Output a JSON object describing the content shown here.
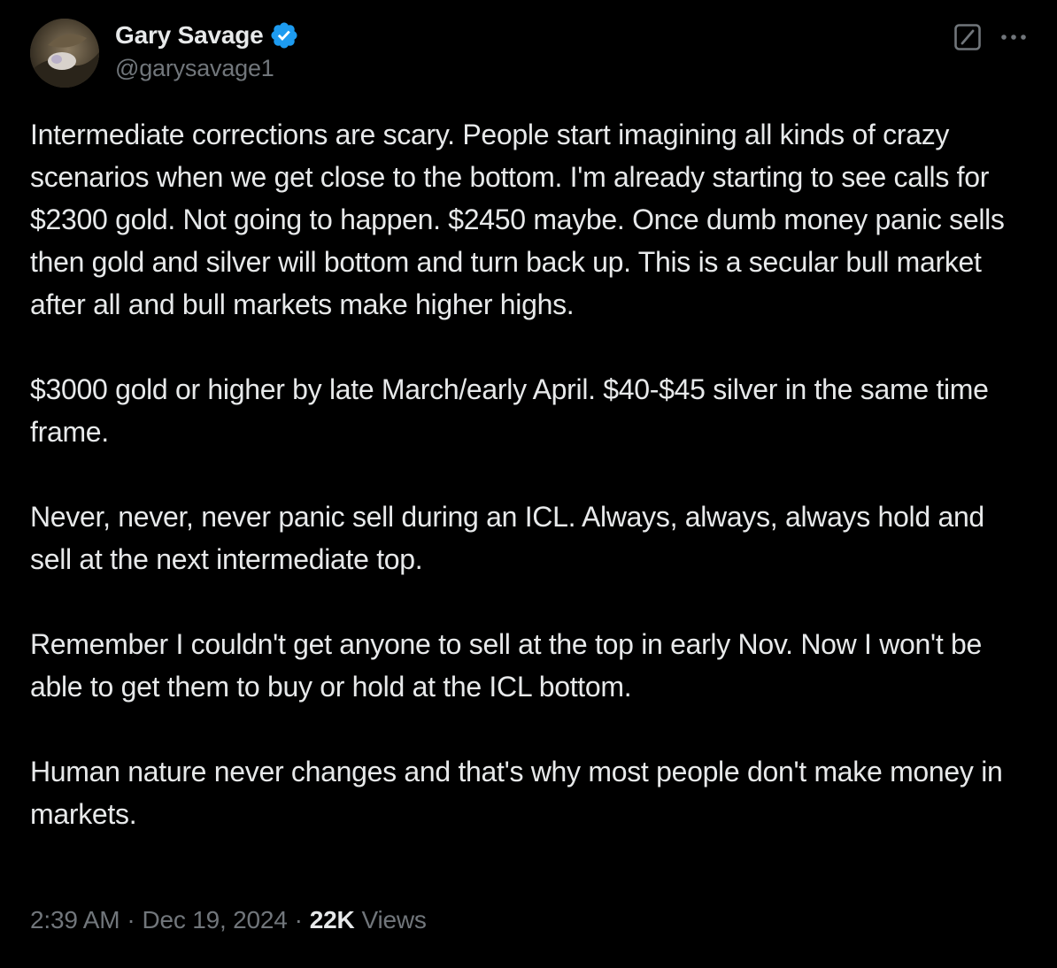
{
  "author": {
    "display_name": "Gary Savage",
    "handle": "@garysavage1",
    "verified_badge_icon": "verified-check-icon",
    "verified_color": "#1d9bf0"
  },
  "header_actions": {
    "grok_icon": "grok-slash-icon",
    "more_icon": "more-horizontal-icon"
  },
  "tweet": {
    "paragraphs": [
      "Intermediate corrections are scary. People start imagining all kinds of crazy scenarios when we get close to the bottom. I'm already starting to see calls for $2300 gold. Not going to happen. $2450 maybe. Once dumb money panic sells then gold and silver will bottom and turn back up. This is a secular bull market after all and bull markets make higher highs.",
      "$3000 gold or higher by late March/early April. $40-$45 silver in the same time frame.",
      "Never, never, never panic sell during an ICL. Always, always, always hold and sell at the next intermediate top.",
      "Remember I couldn't get anyone to sell at the top in early Nov. Now I won't be able to get them to buy or hold at the ICL bottom.",
      "Human nature never changes and that's why most people don't make money in markets."
    ]
  },
  "meta": {
    "time": "2:39 AM",
    "separator": "·",
    "date": "Dec 19, 2024",
    "views_count": "22K",
    "views_label": "Views"
  },
  "colors": {
    "background": "#000000",
    "text_primary": "#e7e9ea",
    "text_secondary": "#71767b"
  }
}
